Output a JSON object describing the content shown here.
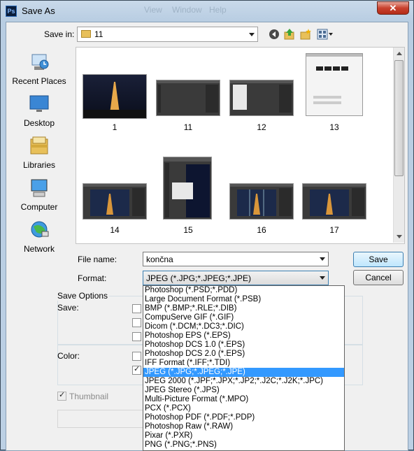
{
  "window": {
    "title": "Save As",
    "icon_label": "Ps",
    "close_label": "✕",
    "menu_ghosts": [
      "View",
      "Window",
      "Help"
    ]
  },
  "toolbar": {
    "save_in_label": "Save in:",
    "save_in_value": "11"
  },
  "places": [
    "Recent Places",
    "Desktop",
    "Libraries",
    "Computer",
    "Network"
  ],
  "files": [
    "1",
    "11",
    "12",
    "13",
    "14",
    "15",
    "16",
    "17"
  ],
  "form": {
    "file_name_label": "File name:",
    "file_name_value": "končna",
    "format_label": "Format:",
    "format_value": "JPEG (*.JPG;*.JPEG;*.JPE)",
    "save_button": "Save",
    "cancel_button": "Cancel"
  },
  "options": {
    "group_title": "Save Options",
    "save_label": "Save:",
    "color_label": "Color:",
    "thumbnail_label": "Thumbnail"
  },
  "format_options": [
    "Photoshop (*.PSD;*.PDD)",
    "Large Document Format (*.PSB)",
    "BMP (*.BMP;*.RLE;*.DIB)",
    "CompuServe GIF (*.GIF)",
    "Dicom (*.DCM;*.DC3;*.DIC)",
    "Photoshop EPS (*.EPS)",
    "Photoshop DCS 1.0 (*.EPS)",
    "Photoshop DCS 2.0 (*.EPS)",
    "IFF Format (*.IFF;*.TDI)",
    "JPEG (*.JPG;*.JPEG;*.JPE)",
    "JPEG 2000 (*.JPF;*.JPX;*.JP2;*.J2C;*.J2K;*.JPC)",
    "JPEG Stereo (*.JPS)",
    "Multi-Picture Format (*.MPO)",
    "PCX (*.PCX)",
    "Photoshop PDF (*.PDF;*.PDP)",
    "Photoshop Raw (*.RAW)",
    "Pixar (*.PXR)",
    "PNG (*.PNG;*.PNS)"
  ],
  "selected_format_index": 9
}
